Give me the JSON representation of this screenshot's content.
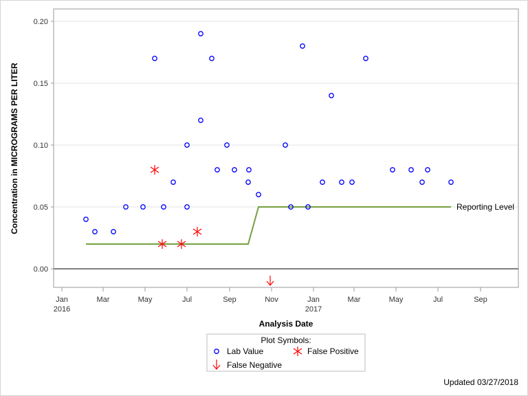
{
  "chart_data": {
    "type": "scatter",
    "title": "",
    "xlabel": "Analysis Date",
    "ylabel": "Concentration in MICROGRAMS PER LITER",
    "ylim": [
      -0.015,
      0.21
    ],
    "xlim": [
      "2015-12-20",
      "2017-10-26"
    ],
    "grid": true,
    "yticks": [
      "0.00",
      "0.05",
      "0.10",
      "0.15",
      "0.20"
    ],
    "ytick_values": [
      0.0,
      0.05,
      0.1,
      0.15,
      0.2
    ],
    "xticks": [
      {
        "date": "2016-01-01",
        "label": "Jan",
        "sub": "2016"
      },
      {
        "date": "2016-03-01",
        "label": "Mar",
        "sub": ""
      },
      {
        "date": "2016-05-01",
        "label": "May",
        "sub": ""
      },
      {
        "date": "2016-07-01",
        "label": "Jul",
        "sub": ""
      },
      {
        "date": "2016-09-01",
        "label": "Sep",
        "sub": ""
      },
      {
        "date": "2016-11-01",
        "label": "Nov",
        "sub": ""
      },
      {
        "date": "2017-01-01",
        "label": "Jan",
        "sub": "2017"
      },
      {
        "date": "2017-03-01",
        "label": "Mar",
        "sub": ""
      },
      {
        "date": "2017-05-01",
        "label": "May",
        "sub": ""
      },
      {
        "date": "2017-07-01",
        "label": "Jul",
        "sub": ""
      },
      {
        "date": "2017-09-01",
        "label": "Sep",
        "sub": ""
      }
    ],
    "series": [
      {
        "name": "Lab Value",
        "marker": "circle",
        "color": "#0000ff",
        "points": [
          {
            "date": "2016-02-05",
            "value": 0.04
          },
          {
            "date": "2016-02-18",
            "value": 0.03
          },
          {
            "date": "2016-03-16",
            "value": 0.03
          },
          {
            "date": "2016-04-03",
            "value": 0.05
          },
          {
            "date": "2016-04-28",
            "value": 0.05
          },
          {
            "date": "2016-05-15",
            "value": 0.17
          },
          {
            "date": "2016-05-28",
            "value": 0.05
          },
          {
            "date": "2016-06-11",
            "value": 0.07
          },
          {
            "date": "2016-07-01",
            "value": 0.1
          },
          {
            "date": "2016-07-01",
            "value": 0.05
          },
          {
            "date": "2016-07-21",
            "value": 0.19
          },
          {
            "date": "2016-07-21",
            "value": 0.12
          },
          {
            "date": "2016-08-06",
            "value": 0.17
          },
          {
            "date": "2016-08-14",
            "value": 0.08
          },
          {
            "date": "2016-08-28",
            "value": 0.1
          },
          {
            "date": "2016-09-08",
            "value": 0.08
          },
          {
            "date": "2016-09-29",
            "value": 0.08
          },
          {
            "date": "2016-09-28",
            "value": 0.07
          },
          {
            "date": "2016-10-13",
            "value": 0.06
          },
          {
            "date": "2016-11-21",
            "value": 0.1
          },
          {
            "date": "2016-11-29",
            "value": 0.05
          },
          {
            "date": "2016-12-16",
            "value": 0.18
          },
          {
            "date": "2016-12-24",
            "value": 0.05
          },
          {
            "date": "2017-01-14",
            "value": 0.07
          },
          {
            "date": "2017-01-27",
            "value": 0.14
          },
          {
            "date": "2017-02-11",
            "value": 0.07
          },
          {
            "date": "2017-02-26",
            "value": 0.07
          },
          {
            "date": "2017-03-18",
            "value": 0.17
          },
          {
            "date": "2017-04-26",
            "value": 0.08
          },
          {
            "date": "2017-05-23",
            "value": 0.08
          },
          {
            "date": "2017-06-08",
            "value": 0.07
          },
          {
            "date": "2017-06-16",
            "value": 0.08
          },
          {
            "date": "2017-07-20",
            "value": 0.07
          }
        ]
      },
      {
        "name": "False Positive",
        "marker": "asterisk",
        "color": "#ff0000",
        "points": [
          {
            "date": "2016-05-15",
            "value": 0.08
          },
          {
            "date": "2016-05-26",
            "value": 0.02
          },
          {
            "date": "2016-06-23",
            "value": 0.02
          },
          {
            "date": "2016-07-16",
            "value": 0.03
          }
        ]
      },
      {
        "name": "False Negative",
        "marker": "down-arrow",
        "color": "#ff0000",
        "points": [
          {
            "date": "2016-10-30",
            "value": -0.01
          }
        ]
      },
      {
        "name": "Reporting Level",
        "type": "step-line",
        "color": "#76a03e",
        "label": "Reporting Level",
        "points": [
          {
            "date": "2016-02-05",
            "value": 0.02
          },
          {
            "date": "2016-09-28",
            "value": 0.02
          },
          {
            "date": "2016-10-13",
            "value": 0.05
          },
          {
            "date": "2017-07-20",
            "value": 0.05
          }
        ]
      }
    ],
    "legend": {
      "title": "Plot Symbols:",
      "position": "bottom-center",
      "items": [
        {
          "label": "Lab Value",
          "marker": "circle"
        },
        {
          "label": "False Positive",
          "marker": "asterisk"
        },
        {
          "label": "False Negative",
          "marker": "down-arrow"
        }
      ]
    },
    "reference_line": {
      "value": 0.0,
      "color": "#808080"
    }
  },
  "footer": {
    "updated": "Updated 03/27/2018"
  }
}
